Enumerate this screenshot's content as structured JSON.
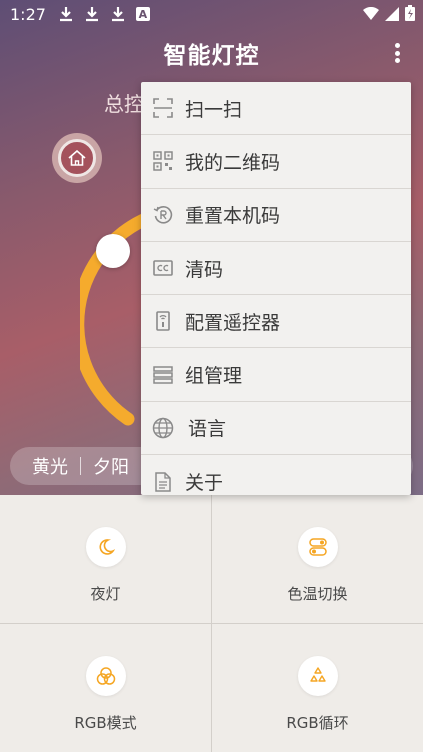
{
  "status_bar": {
    "time": "1:27",
    "a_badge": "A"
  },
  "header": {
    "title": "智能灯控"
  },
  "main": {
    "total_label": "总控"
  },
  "mode_bar": {
    "items": [
      "黄光",
      "夕阳"
    ]
  },
  "menu": {
    "items": [
      {
        "label": "扫一扫",
        "icon": "scan-icon"
      },
      {
        "label": "我的二维码",
        "icon": "qr-code-icon"
      },
      {
        "label": "重置本机码",
        "icon": "reset-icon"
      },
      {
        "label": "清码",
        "icon": "cc-icon"
      },
      {
        "label": "配置遥控器",
        "icon": "remote-icon"
      },
      {
        "label": "组管理",
        "icon": "group-icon"
      },
      {
        "label": "语言",
        "icon": "globe-icon"
      },
      {
        "label": "关于",
        "icon": "document-icon"
      }
    ]
  },
  "grid": {
    "items": [
      {
        "label": "夜灯",
        "icon": "moon-icon"
      },
      {
        "label": "色温切换",
        "icon": "toggle-icon"
      },
      {
        "label": "RGB模式",
        "icon": "rgb-circles-icon"
      },
      {
        "label": "RGB循环",
        "icon": "recycle-icon"
      }
    ]
  },
  "colors": {
    "accent": "#f5a623",
    "menu_icon": "#7a7a7a"
  }
}
